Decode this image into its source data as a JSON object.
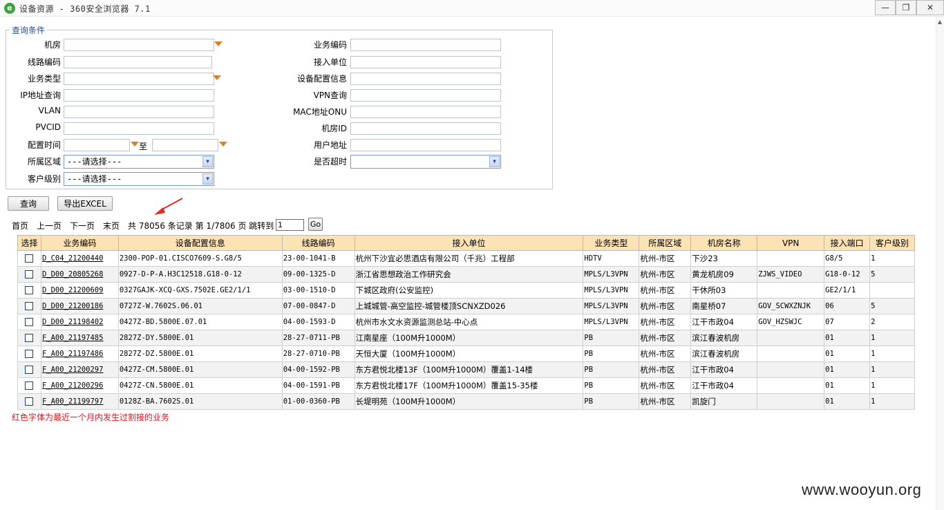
{
  "window": {
    "title": "设备资源 - 360安全浏览器 7.1",
    "min_glyph": "—",
    "max_glyph": "❐",
    "close_glyph": "✕",
    "app_icon_glyph": "e"
  },
  "query": {
    "legend": "查询条件",
    "left_fields": [
      {
        "label": "机房",
        "value": ""
      },
      {
        "label": "线路编码",
        "value": ""
      },
      {
        "label": "业务类型",
        "value": ""
      },
      {
        "label": "IP地址查询",
        "value": ""
      },
      {
        "label": "VLAN",
        "value": ""
      },
      {
        "label": "PVCID",
        "value": ""
      },
      {
        "label": "配置时间",
        "value": "",
        "to_label": "至",
        "value2": ""
      },
      {
        "label": "所属区域",
        "value": "---请选择---"
      },
      {
        "label": "客户级别",
        "value": "---请选择---"
      }
    ],
    "right_fields": [
      {
        "label": "业务编码",
        "value": ""
      },
      {
        "label": "接入单位",
        "value": ""
      },
      {
        "label": "设备配置信息",
        "value": ""
      },
      {
        "label": "VPN查询",
        "value": ""
      },
      {
        "label": "MAC地址ONU",
        "value": ""
      },
      {
        "label": "机房ID",
        "value": ""
      },
      {
        "label": "用户地址",
        "value": ""
      },
      {
        "label": "是否超时",
        "value": ""
      }
    ],
    "search_button": "查询",
    "export_button": "导出EXCEL"
  },
  "pager": {
    "first": "首页",
    "prev": "上一页",
    "next": "下一页",
    "last": "末页",
    "summary": "共 78056 条记录 第 1/7806 页 跳转到",
    "goto_value": "1",
    "go_label": "Go"
  },
  "table": {
    "headers": [
      "选择",
      "业务编码",
      "设备配置信息",
      "线路编码",
      "接入单位",
      "业务类型",
      "所属区域",
      "机房名称",
      "VPN",
      "接入端口",
      "客户级别"
    ],
    "rows": [
      [
        "D_C04_21200440",
        "2300-POP-01.CISCO7609-S.G8/5",
        "23-00-1041-B",
        "杭州下沙宜必思酒店有限公司（千兆）工程部",
        "HDTV",
        "杭州-市区",
        "下沙23",
        "",
        "G8/5",
        "1"
      ],
      [
        "D_D00_20805268",
        "0927-D-P-A.H3C12518.G18-0-12",
        "09-00-1325-D",
        "浙江省思想政治工作研究会",
        "MPLS/L3VPN",
        "杭州-市区",
        "黄龙机房09",
        "ZJWS_VIDEO",
        "G18-0-12",
        "5"
      ],
      [
        "D_D00_21200609",
        "0327GAJK-XCQ-GXS.7502E.GE2/1/1",
        "03-00-1510-D",
        "下城区政府(公安监控)",
        "MPLS/L3VPN",
        "杭州-市区",
        "干休所03",
        "",
        "GE2/1/1",
        ""
      ],
      [
        "D_D00_21200186",
        "0727Z-W.7602S.06.01",
        "07-00-0847-D",
        "上城城管-高空监控-城管楼顶SCNXZD026",
        "MPLS/L3VPN",
        "杭州-市区",
        "南星桥07",
        "GOV_SCWXZNJK",
        "06",
        "5"
      ],
      [
        "D_D00_21198402",
        "0427Z-BD.5800E.07.01",
        "04-00-1593-D",
        "杭州市水文水资源监测总站-中心点",
        "MPLS/L3VPN",
        "杭州-市区",
        "江干市政04",
        "GOV_HZSWJC",
        "07",
        "2"
      ],
      [
        "F_A00_21197485",
        "2827Z-DY.5800E.01",
        "28-27-0711-PB",
        "江南星座（100M升1000M）",
        "PB",
        "杭州-市区",
        "滨江春波机房",
        "",
        "01",
        "1"
      ],
      [
        "F_A00_21197486",
        "2827Z-DZ.5800E.01",
        "28-27-0710-PB",
        "天恒大厦（100M升1000M）",
        "PB",
        "杭州-市区",
        "滨江春波机房",
        "",
        "01",
        "1"
      ],
      [
        "F_A00_21200297",
        "0427Z-CM.5800E.01",
        "04-00-1592-PB",
        "东方君悦北楼13F（100M升1000M）覆盖1-14楼",
        "PB",
        "杭州-市区",
        "江干市政04",
        "",
        "01",
        "1"
      ],
      [
        "F_A00_21200296",
        "0427Z-CN.5800E.01",
        "04-00-1591-PB",
        "东方君悦北楼17F（100M升1000M）覆盖15-35楼",
        "PB",
        "杭州-市区",
        "江干市政04",
        "",
        "01",
        "1"
      ],
      [
        "F_A00_21199797",
        "0128Z-BA.7602S.01",
        "01-00-0360-PB",
        "长堤明苑（100M升1000M）",
        "PB",
        "杭州-市区",
        "凯旋门",
        "",
        "01",
        "1"
      ]
    ]
  },
  "note": "红色字体为最近一个月内发生过割接的业务",
  "watermark": "www.wooyun.org",
  "colors": {
    "header_bg": "#fde2b3",
    "note_red": "#e0141e",
    "arrow_red": "#e8291f",
    "dropdown_orange": "#d9801f"
  }
}
